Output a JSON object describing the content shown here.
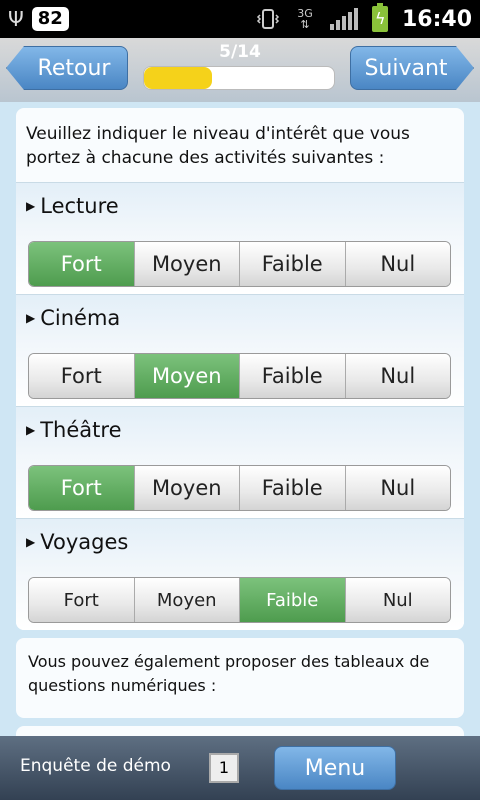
{
  "status_bar": {
    "usb_icon": "usb-icon",
    "notification_count": "82",
    "network_type": "3G",
    "time": "16:40"
  },
  "header": {
    "back_label": "Retour",
    "next_label": "Suivant",
    "progress_text": "5/14",
    "progress_fraction": 0.357
  },
  "survey": {
    "intro": "Veuillez indiquer le niveau d'intérêt que vous portez à chacune des activités suivantes :",
    "options": [
      "Fort",
      "Moyen",
      "Faible",
      "Nul"
    ],
    "activities": [
      {
        "label": "Lecture",
        "selected": "Fort"
      },
      {
        "label": "Cinéma",
        "selected": "Moyen"
      },
      {
        "label": "Théâtre",
        "selected": "Fort"
      },
      {
        "label": "Voyages",
        "selected": "Faible"
      }
    ],
    "info_text": "Vous pouvez également proposer des tableaux de questions numériques :"
  },
  "footer": {
    "survey_name": "Enquête de démo",
    "page_number": "1",
    "menu_label": "Menu"
  },
  "colors": {
    "selected": "#5aa85a",
    "nav_button": "#5b95d3",
    "progress": "#f5d21a"
  }
}
